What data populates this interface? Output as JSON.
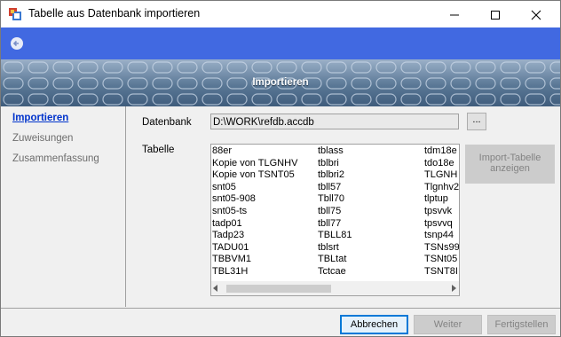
{
  "window": {
    "title": "Tabelle aus Datenbank importieren",
    "controls": {
      "minimize": "—",
      "maximize": "☐",
      "close": "✕"
    }
  },
  "banner": {
    "title": "Importieren"
  },
  "sidebar": {
    "items": [
      {
        "label": "Importieren",
        "active": true
      },
      {
        "label": "Zuweisungen",
        "active": false
      },
      {
        "label": "Zusammenfassung",
        "active": false
      }
    ]
  },
  "form": {
    "database_label": "Datenbank",
    "database_value": "D:\\WORK\\refdb.accdb",
    "browse_label": "...",
    "table_label": "Tabelle",
    "import_button": "Import-Tabelle anzeigen",
    "tables": {
      "col1": [
        "88er",
        "Kopie von TLGNHV",
        "Kopie von TSNT05",
        "snt05",
        "snt05-908",
        "snt05-ts",
        "tadp01",
        "Tadp23",
        "TADU01",
        "TBBVM1",
        "TBL31H"
      ],
      "col2": [
        "tblass",
        "tblbri",
        "tblbri2",
        "tbll57",
        "Tbll70",
        "tbll75",
        "tbll77",
        "TBLL81",
        "tblsrt",
        "TBLtat",
        "Tctcae"
      ],
      "col3": [
        "tdm18e",
        "tdo18e",
        "TLGNH",
        "Tlgnhv2",
        "tlptup",
        "tpsvvk",
        "tpsvvq",
        "tsnp44",
        "TSNs99",
        "TSNt05",
        "TSNT8I"
      ]
    }
  },
  "footer": {
    "cancel": "Abbrechen",
    "next": "Weiter",
    "finish": "Fertigstellen"
  },
  "colors": {
    "nav_bar": "#4169e1",
    "active_link": "#0033cc",
    "primary_border": "#0078d7"
  }
}
